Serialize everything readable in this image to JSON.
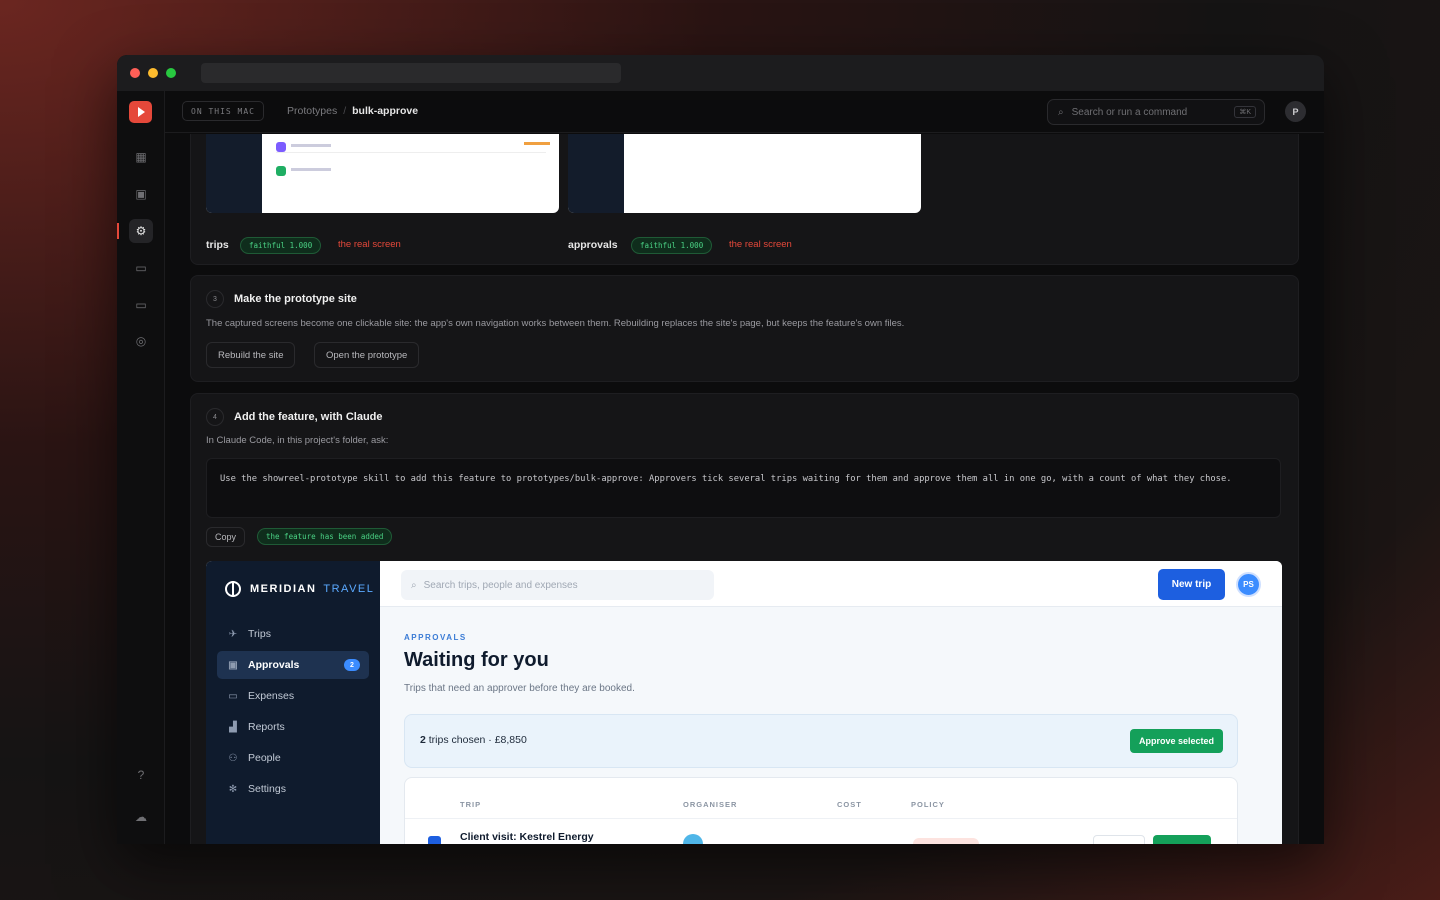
{
  "topbar": {
    "location_chip": "ON THIS MAC",
    "breadcrumb": [
      "Prototypes",
      "bulk-approve"
    ],
    "search_placeholder": "Search or run a command",
    "search_shortcut": "⌘K",
    "avatar": "P"
  },
  "captures": [
    {
      "label": "trips",
      "status": "faithful 1.000",
      "note": "the real screen"
    },
    {
      "label": "approvals",
      "status": "faithful 1.000",
      "note": "the real screen"
    }
  ],
  "step3": {
    "number": "3",
    "title": "Make the prototype site",
    "description": "The captured screens become one clickable site: the app's own navigation works between them. Rebuilding replaces the site's page, but keeps the feature's own files.",
    "buttons": [
      "Rebuild the site",
      "Open the prototype"
    ]
  },
  "step4": {
    "number": "4",
    "title": "Add the feature, with Claude",
    "description": "In Claude Code, in this project's folder, ask:",
    "prompt": "Use the showreel-prototype skill to add this feature to prototypes/bulk-approve: Approvers tick several trips waiting for them and approve them all in one go, with a count of what they chose.",
    "copy_label": "Copy",
    "status": "the feature has been added"
  },
  "preview": {
    "brand": "MERIDIAN",
    "brand_accent": "TRAVEL",
    "nav": [
      {
        "label": "Trips",
        "icon": "plane-icon"
      },
      {
        "label": "Approvals",
        "icon": "approval-icon",
        "badge": "2"
      },
      {
        "label": "Expenses",
        "icon": "receipt-icon"
      },
      {
        "label": "Reports",
        "icon": "chart-icon"
      },
      {
        "label": "People",
        "icon": "people-icon"
      },
      {
        "label": "Settings",
        "icon": "gear-icon"
      }
    ],
    "search_placeholder": "Search trips, people and expenses",
    "new_trip": "New trip",
    "user_initials": "PS",
    "eyebrow": "APPROVALS",
    "title": "Waiting for you",
    "subtitle": "Trips that need an approver before they are booked.",
    "selection_count": "2",
    "selection_text": "trips chosen · £8,850",
    "approve_selected": "Approve selected",
    "table_headers": [
      "TRIP",
      "ORGANISER",
      "COST",
      "POLICY"
    ],
    "first_row_trip": "Client visit: Kestrel Energy"
  }
}
